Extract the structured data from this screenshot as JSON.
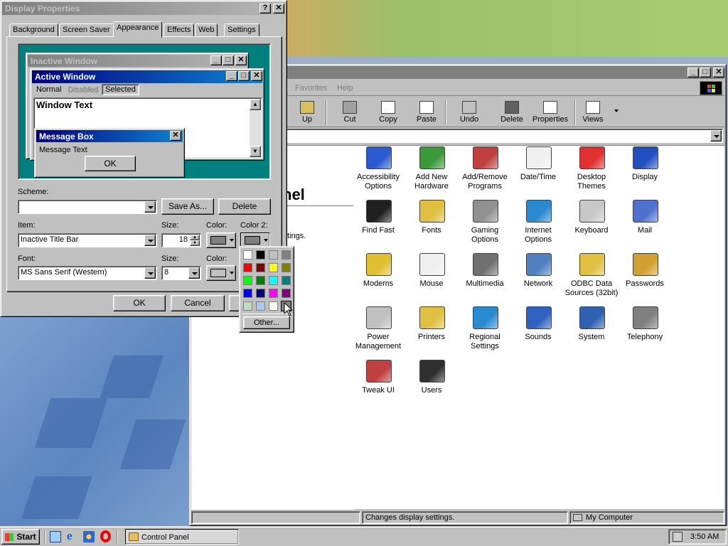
{
  "display_props": {
    "title": "Display Properties",
    "help_btn": "?",
    "close_btn": "✕",
    "tabs": [
      "Background",
      "Screen Saver",
      "Appearance",
      "Effects",
      "Web",
      "Settings"
    ],
    "preview": {
      "inactive_title": "Inactive Window",
      "active_title": "Active Window",
      "menu_normal": "Normal",
      "menu_disabled": "Disabled",
      "menu_selected": "Selected",
      "window_text": "Window Text",
      "msgbox_title": "Message Box",
      "msgbox_text": "Message Text",
      "msgbox_ok": "OK"
    },
    "scheme_label": "Scheme:",
    "scheme_value": "",
    "save_as": "Save As...",
    "delete": "Delete",
    "item_label": "Item:",
    "item_value": "Inactive Title Bar",
    "size_label": "Size:",
    "item_size": "18",
    "color_label": "Color:",
    "color2_label": "Color 2:",
    "font_label": "Font:",
    "font_value": "MS Sans Serif (Western)",
    "font_size_label": "Size:",
    "font_size": "8",
    "font_color_label": "Color:",
    "ok": "OK",
    "cancel": "Cancel",
    "other": "Other...",
    "palette": [
      "#ffffff",
      "#000000",
      "#c0c0c0",
      "#808080",
      "#ff0000",
      "#800000",
      "#ffff00",
      "#808000",
      "#00ff00",
      "#008000",
      "#00ffff",
      "#008080",
      "#0000ff",
      "#000080",
      "#ff00ff",
      "#800080",
      "#c0dcc0",
      "#a6caf0",
      "#fffbf0",
      "#808080"
    ]
  },
  "control_panel": {
    "menu_favorites": "Favorites",
    "menu_help": "Help",
    "heading_fragment": "nel",
    "info_fragment": "ttings.",
    "toolbar": [
      "Up",
      "Cut",
      "Copy",
      "Paste",
      "Undo",
      "Delete",
      "Properties",
      "Views"
    ],
    "items": [
      {
        "label": "Accessibility\nOptions",
        "icon": "accessibility-icon"
      },
      {
        "label": "Add New\nHardware",
        "icon": "hardware-icon"
      },
      {
        "label": "Add/Remove\nPrograms",
        "icon": "programs-icon"
      },
      {
        "label": "Date/Time",
        "icon": "calendar-icon"
      },
      {
        "label": "Desktop\nThemes",
        "icon": "themes-icon"
      },
      {
        "label": "Display",
        "icon": "display-icon"
      },
      {
        "label": "Find Fast",
        "icon": "binoculars-icon"
      },
      {
        "label": "Fonts",
        "icon": "fonts-icon"
      },
      {
        "label": "Gaming\nOptions",
        "icon": "joystick-icon"
      },
      {
        "label": "Internet\nOptions",
        "icon": "globe-icon"
      },
      {
        "label": "Keyboard",
        "icon": "keyboard-icon"
      },
      {
        "label": "Mail",
        "icon": "mail-icon"
      },
      {
        "label": "Modems",
        "icon": "modem-icon"
      },
      {
        "label": "Mouse",
        "icon": "mouse-icon"
      },
      {
        "label": "Multimedia",
        "icon": "multimedia-icon"
      },
      {
        "label": "Network",
        "icon": "network-icon"
      },
      {
        "label": "ODBC Data\nSources (32bit)",
        "icon": "odbc-icon"
      },
      {
        "label": "Passwords",
        "icon": "keys-icon"
      },
      {
        "label": "Power\nManagement",
        "icon": "power-icon"
      },
      {
        "label": "Printers",
        "icon": "printer-icon"
      },
      {
        "label": "Regional\nSettings",
        "icon": "globe-icon"
      },
      {
        "label": "Sounds",
        "icon": "sounds-icon"
      },
      {
        "label": "System",
        "icon": "computer-icon"
      },
      {
        "label": "Telephony",
        "icon": "telephone-icon"
      },
      {
        "label": "Tweak UI",
        "icon": "tweakui-icon"
      },
      {
        "label": "Users",
        "icon": "users-icon"
      }
    ],
    "status_text": "Changes display settings.",
    "status_location": "My Computer"
  },
  "taskbar": {
    "start": "Start",
    "task_control_panel": "Control Panel",
    "clock": "3:50 AM"
  }
}
